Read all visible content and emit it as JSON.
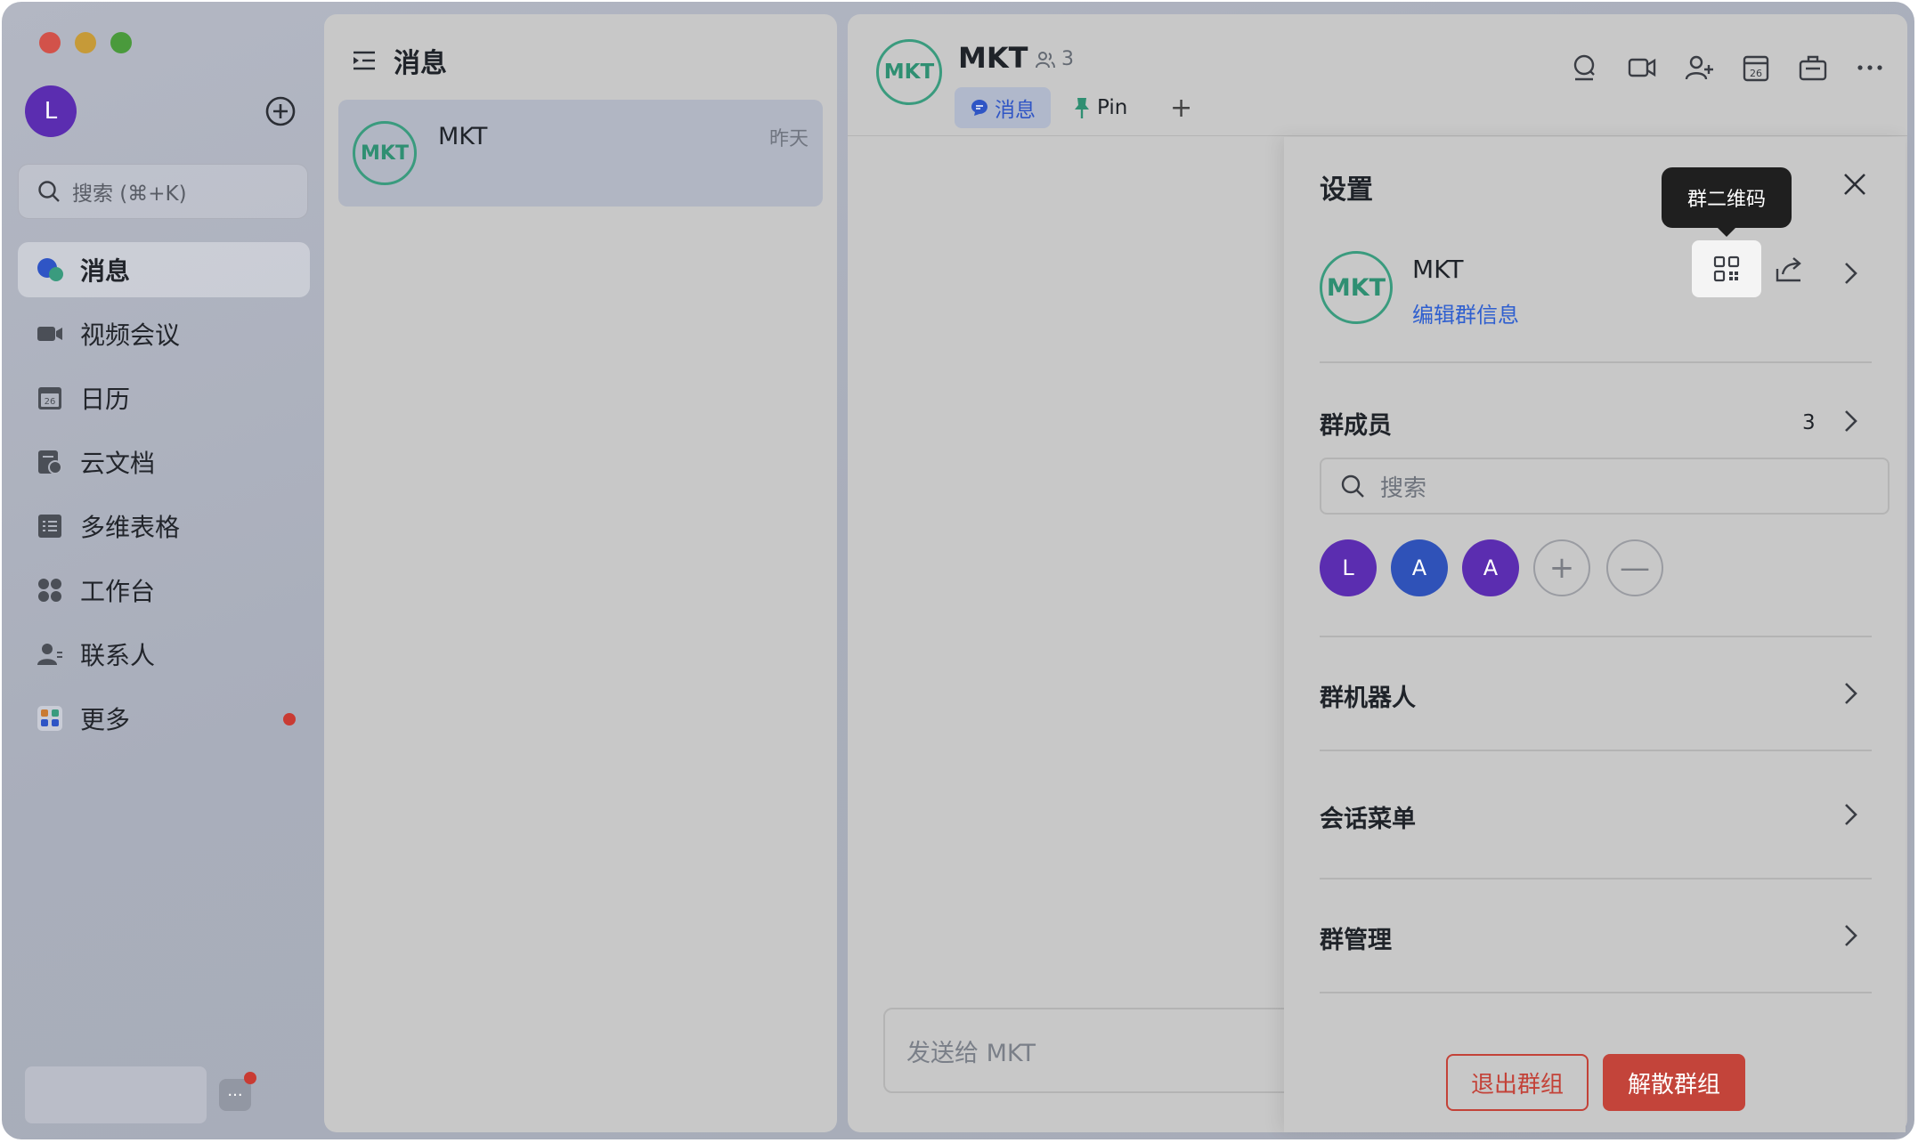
{
  "sidebar": {
    "avatar_initial": "L",
    "search_placeholder": "搜索 (⌘+K)",
    "items": [
      {
        "label": "消息",
        "icon": "chat-bubble-icon"
      },
      {
        "label": "视频会议",
        "icon": "video-camera-icon"
      },
      {
        "label": "日历",
        "icon": "calendar-icon"
      },
      {
        "label": "云文档",
        "icon": "cloud-doc-icon"
      },
      {
        "label": "多维表格",
        "icon": "table-icon"
      },
      {
        "label": "工作台",
        "icon": "grid-apps-icon"
      },
      {
        "label": "联系人",
        "icon": "contacts-icon"
      },
      {
        "label": "更多",
        "icon": "more-apps-icon"
      }
    ],
    "more_button": "···"
  },
  "message_list": {
    "title": "消息",
    "conversations": [
      {
        "avatar": "MKT",
        "name": "MKT",
        "time": "昨天"
      }
    ]
  },
  "chat": {
    "avatar": "MKT",
    "title": "MKT",
    "member_count": "3",
    "tabs": [
      {
        "label": "消息"
      },
      {
        "label": "Pin"
      }
    ],
    "add_tab": "+",
    "composer_placeholder": "发送给 MKT"
  },
  "settings": {
    "title": "设置",
    "tooltip": "群二维码",
    "group_avatar": "MKT",
    "group_name": "MKT",
    "edit_info": "编辑群信息",
    "members_label": "群成员",
    "members_count": "3",
    "member_search_placeholder": "搜索",
    "members": [
      "L",
      "A",
      "A"
    ],
    "add_member": "+",
    "remove_member": "—",
    "bots_label": "群机器人",
    "menu_label": "会话菜单",
    "admin_label": "群管理",
    "quit_button": "退出群组",
    "dissolve_button": "解散群组"
  },
  "colors": {
    "accent_blue": "#2f5fcf",
    "danger_red": "#c3443a",
    "mkt_green": "#3a9b7e",
    "avatar_purple": "#5b2db0"
  }
}
